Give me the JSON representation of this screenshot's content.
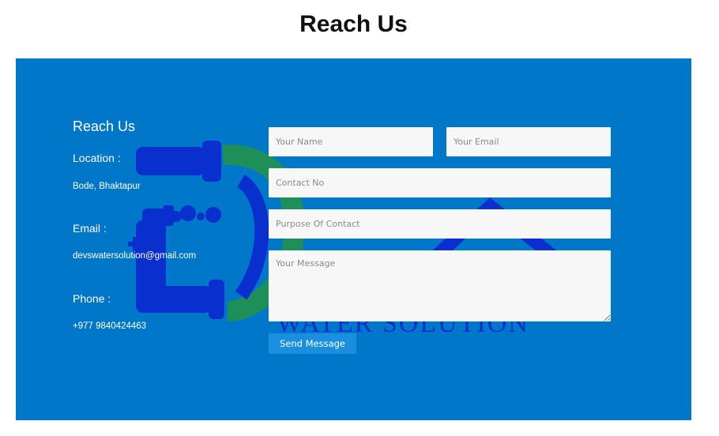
{
  "page_title": "Reach Us",
  "watermark": {
    "logo_text": "WATER SOLUTION"
  },
  "info": {
    "heading": "Reach Us",
    "location_label": "Location :",
    "location_value": "Bode, Bhaktapur",
    "email_label": "Email :",
    "email_value": "devswatersolution@gmail.com",
    "phone_label": "Phone :",
    "phone_value": "+977 9840424463"
  },
  "form": {
    "name_placeholder": "Your Name",
    "email_placeholder": "Your Email",
    "contact_placeholder": "Contact No",
    "purpose_placeholder": "Purpose Of Contact",
    "message_placeholder": "Your Message",
    "submit_label": "Send Message"
  },
  "colors": {
    "panel_bg": "#0077c8",
    "button_bg": "#1a8fe0",
    "logo_blue": "#0a2fcf",
    "logo_green": "#1f8f5a"
  }
}
